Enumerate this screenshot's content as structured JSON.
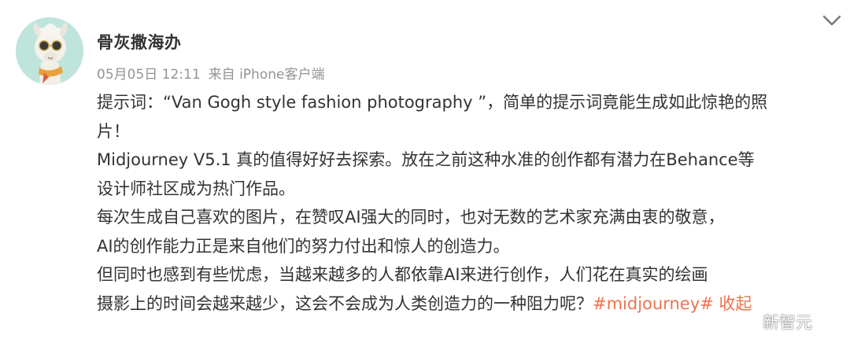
{
  "post": {
    "author": "骨灰撒海办",
    "date": "05月05日 12:11",
    "source": "来自 iPhone客户端",
    "menu_icon": "chevron-down-icon",
    "body_lines": [
      "提示词：“Van Gogh style fashion photography ”，简单的提示词竟能生成如此惊艳的照",
      "片！",
      "Midjourney V5.1 真的值得好好去探索。放在之前这种水准的创作都有潜力在Behance等",
      "设计师社区成为热门作品。",
      "每次生成自己喜欢的图片，在赞叹AI强大的同时，也对无数的艺术家充满由衷的敬意，",
      "AI的创作能力正是来自他们的努力付出和惊人的创造力。",
      "但同时也感到有些忧虑，当越来越多的人都依靠AI来进行创作，人们花在真实的绘画",
      "摄影上的时间会越来越少，这会不会成为人类创造力的一种阻力呢？"
    ],
    "hashtag": "#midjourney#",
    "collapse_label": "收起"
  },
  "watermark": {
    "text": "新智元",
    "icon": "wechat-icon"
  },
  "colors": {
    "text": "#333333",
    "meta": "#939393",
    "accent": "#eb7350",
    "avatar_bg": "#bfe4dc"
  }
}
